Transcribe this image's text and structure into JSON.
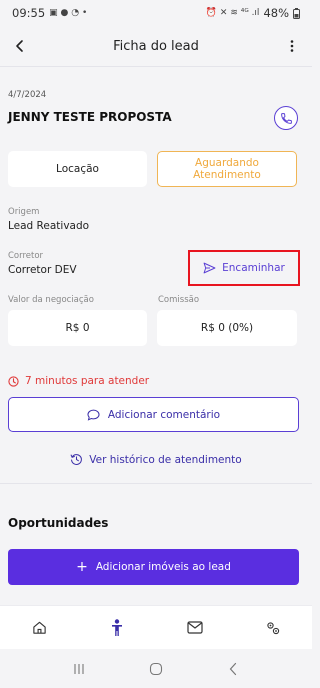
{
  "status_bar": {
    "time": "09:55",
    "left_icons": "▣ ● ◔ •",
    "right_icons": "⏰ ✕ ≋ ⁴ᴳ .ıl",
    "battery": "48%"
  },
  "header": {
    "title": "Ficha do lead",
    "back_icon": "back-arrow-icon",
    "menu_icon": "more-vert-icon"
  },
  "lead": {
    "date": "4/7/2024",
    "name": "JENNY TESTE PROPOSTA",
    "type": "Locação",
    "status": "Aguardando\nAtendimento",
    "origin_label": "Origem",
    "origin": "Lead Reativado",
    "broker_label": "Corretor",
    "broker": "Corretor DEV",
    "forward_label": "Encaminhar",
    "negotiation_label": "Valor da negociação",
    "negotiation_value": "R$ 0",
    "commission_label": "Comissão",
    "commission_value": "R$ 0 (0%)"
  },
  "alert": {
    "text": "7 minutos para atender",
    "color": "#e03a3a"
  },
  "actions": {
    "add_comment": "Adicionar comentário",
    "view_history": "Ver histórico de atendimento"
  },
  "opportunities": {
    "title": "Oportunidades",
    "add_properties": "Adicionar imóveis ao lead"
  },
  "bottom_nav": [
    {
      "icon": "home-icon",
      "active": false
    },
    {
      "icon": "person-icon",
      "active": true
    },
    {
      "icon": "mail-icon",
      "active": false
    },
    {
      "icon": "settings-icon",
      "active": false
    }
  ],
  "colors": {
    "accent": "#5a3fd4",
    "primary_button": "#5a2ee0",
    "status_border": "#f0b555",
    "highlight_box": "#e8141f"
  }
}
